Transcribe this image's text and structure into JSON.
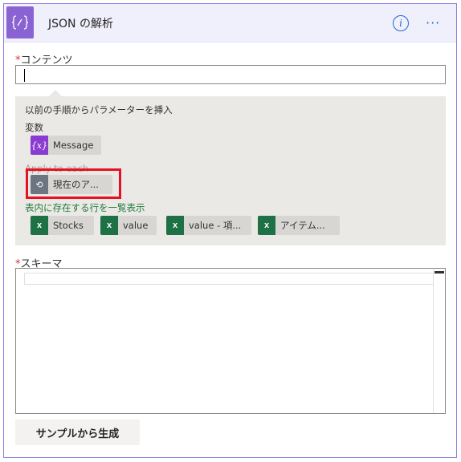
{
  "header": {
    "title": "JSON の解析",
    "icon": "braces-icon",
    "info_glyph": "i",
    "more_glyph": "···"
  },
  "content_field": {
    "required_mark": "*",
    "label": "コンテンツ",
    "value": ""
  },
  "dynamic_panel": {
    "heading": "以前の手順からパラメーターを挿入",
    "sections": [
      {
        "title": "変数",
        "tokens": [
          {
            "label": "Message",
            "icon": "variable-icon",
            "icon_text": "{x}"
          }
        ]
      },
      {
        "title": "Apply to each",
        "tokens": [
          {
            "label": "現在のア...",
            "icon": "loop-icon",
            "icon_text": "⟲"
          }
        ]
      },
      {
        "title": "表内に存在する行を一覧表示",
        "tokens": [
          {
            "label": "Stocks",
            "icon": "excel-icon",
            "icon_text": "x"
          },
          {
            "label": "value",
            "icon": "excel-icon",
            "icon_text": "x"
          },
          {
            "label": "value - 項...",
            "icon": "excel-icon",
            "icon_text": "x"
          },
          {
            "label": "アイテム...",
            "icon": "excel-icon",
            "icon_text": "x"
          }
        ]
      }
    ]
  },
  "schema_field": {
    "required_mark": "*",
    "label": "スキーマ",
    "value": ""
  },
  "generate_button": {
    "label": "サンプルから生成"
  },
  "colors": {
    "accent": "#8a63d2",
    "excel": "#1e7145",
    "highlight": "#e81123",
    "link": "#2266d2"
  }
}
